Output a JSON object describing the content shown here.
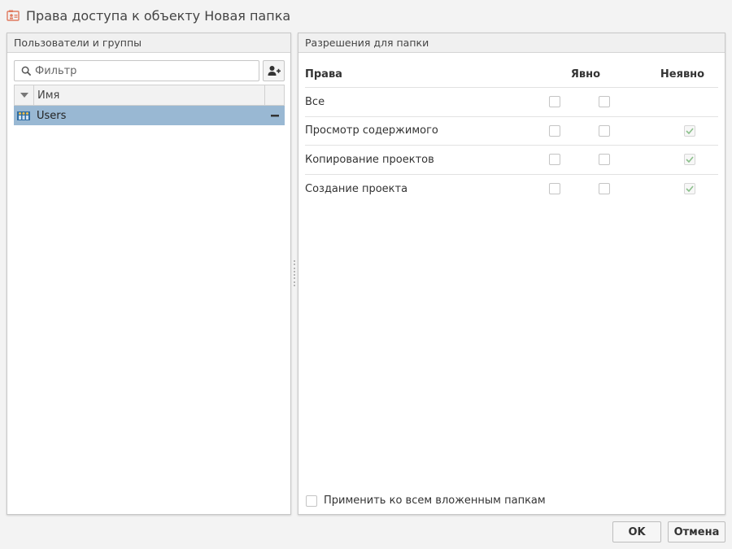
{
  "window": {
    "title": "Права доступа к объекту Новая папка",
    "icon": "folder-permissions-icon"
  },
  "left_panel": {
    "header": "Пользователи и группы",
    "filter": {
      "placeholder": "Фильтр",
      "value": ""
    },
    "grid": {
      "column_name": "Имя",
      "rows": [
        {
          "name": "Users",
          "icon": "user-group-icon",
          "selected": true
        }
      ]
    }
  },
  "right_panel": {
    "header": "Разрешения для папки",
    "columns": {
      "rights": "Права",
      "explicit": "Явно",
      "implicit": "Неявно"
    },
    "permissions": [
      {
        "name": "Все",
        "explicit_a": false,
        "explicit_b": false,
        "implicit": null
      },
      {
        "name": "Просмотр содержимого",
        "explicit_a": false,
        "explicit_b": false,
        "implicit": true
      },
      {
        "name": "Копирование проектов",
        "explicit_a": false,
        "explicit_b": false,
        "implicit": true
      },
      {
        "name": "Создание проекта",
        "explicit_a": false,
        "explicit_b": false,
        "implicit": true
      }
    ],
    "apply_all_label": "Применить ко всем вложенным папкам",
    "apply_all_checked": false
  },
  "buttons": {
    "ok": "OK",
    "cancel": "Отмена"
  },
  "colors": {
    "selected_row": "#99b8d3",
    "implicit_check": "#8cc08c",
    "title_icon": "#e07a5f"
  }
}
